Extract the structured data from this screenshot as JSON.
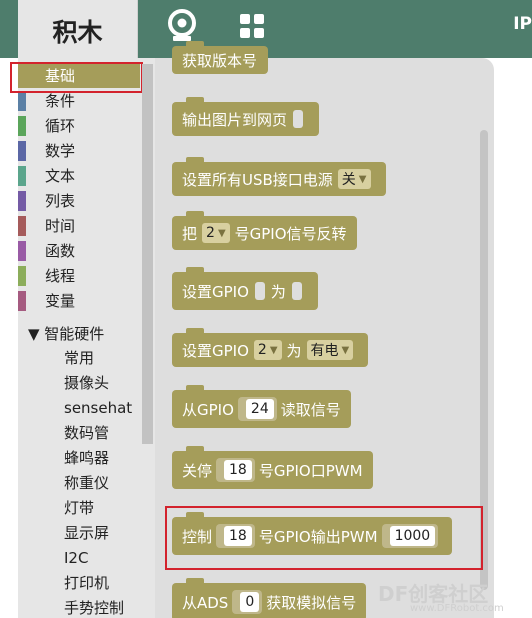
{
  "header": {
    "brand": "积木",
    "camera_icon": "webcam-icon",
    "grid_icon": "grid-icon",
    "right_text": "IP"
  },
  "toolbox": {
    "categories": [
      {
        "label": "基础",
        "color": "#a59d5a"
      },
      {
        "label": "条件",
        "color": "#5b80a5"
      },
      {
        "label": "循环",
        "color": "#5ba55b"
      },
      {
        "label": "数学",
        "color": "#5b67a5"
      },
      {
        "label": "文本",
        "color": "#5ba58c"
      },
      {
        "label": "列表",
        "color": "#745ba5"
      },
      {
        "label": "时间",
        "color": "#a55b5b"
      },
      {
        "label": "函数",
        "color": "#995ba5"
      },
      {
        "label": "线程",
        "color": "#8cad5b"
      },
      {
        "label": "变量",
        "color": "#a55b80"
      }
    ],
    "hardware_group": "▼ 智能硬件",
    "hardware_items": [
      "常用",
      "摄像头",
      "sensehat",
      "数码管",
      "蜂鸣器",
      "称重仪",
      "灯带",
      "显示屏",
      "I2C",
      "打印机",
      "手势控制"
    ]
  },
  "flyout": {
    "block_version": "获取版本号",
    "block_image": "输出图片到网页",
    "block_usb": {
      "text": "设置所有USB接口电源",
      "option": "关"
    },
    "block_invert": {
      "pre": "把",
      "option": "2",
      "post": "号GPIO信号反转"
    },
    "block_set_gpio": {
      "pre": "设置GPIO",
      "mid": "为"
    },
    "block_set_gpio2": {
      "pre": "设置GPIO",
      "option": "2",
      "mid": "为",
      "option2": "有电"
    },
    "block_read": {
      "pre": "从GPIO",
      "value": "24",
      "post": "读取信号"
    },
    "block_pwm_off": {
      "pre": "关停",
      "value": "18",
      "post": "号GPIO口PWM"
    },
    "block_pwm_ctrl": {
      "pre": "控制",
      "value": "18",
      "mid": "号GPIO输出PWM",
      "value2": "1000"
    },
    "block_ads": {
      "pre": "从ADS",
      "value": "0",
      "post": "获取模拟信号"
    }
  },
  "watermark": {
    "main": "DF创客社区",
    "sub": "www.DFRobot.com"
  },
  "colors": {
    "topbar": "#4e7d6c",
    "block": "#a59d5a",
    "highlight": "#d3232d"
  }
}
